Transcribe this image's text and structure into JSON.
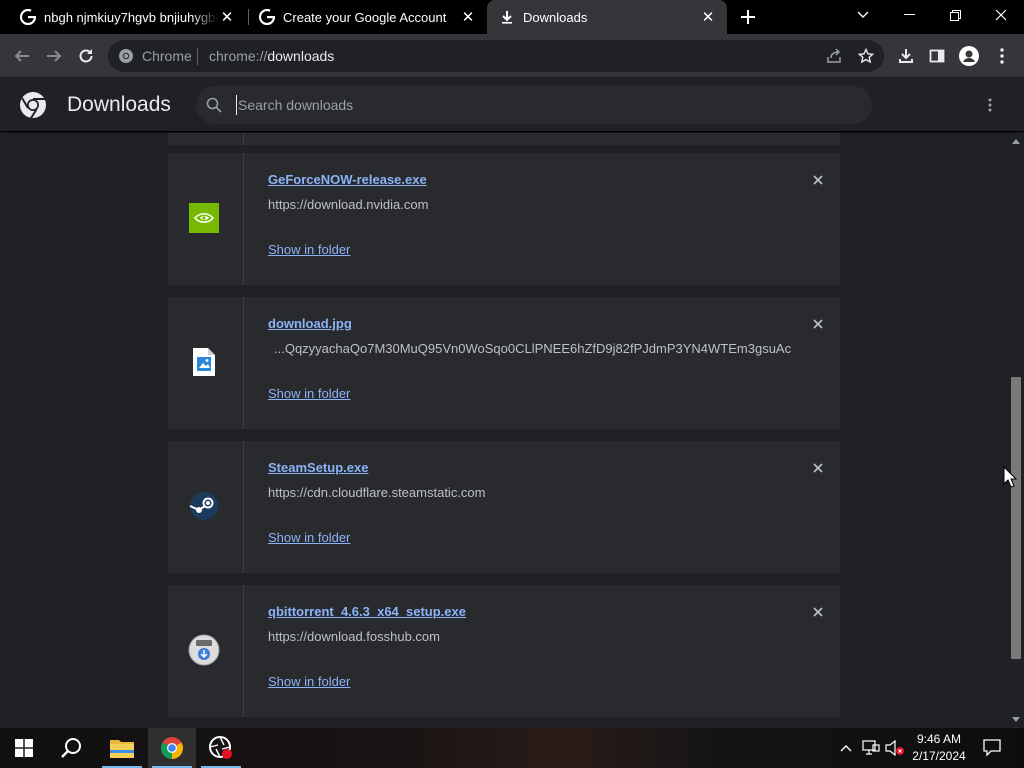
{
  "browser": {
    "tabs": [
      {
        "title": "nbgh njmkiuy7hgvb bnjiuhygbh",
        "active": false
      },
      {
        "title": "Create your Google Account",
        "active": false
      },
      {
        "title": "Downloads",
        "active": true
      }
    ],
    "omnibox": {
      "scheme_label": "Chrome",
      "url_prefix": "chrome://",
      "url_host": "downloads"
    }
  },
  "page": {
    "title": "Downloads",
    "search_placeholder": "Search downloads"
  },
  "downloads": [
    {
      "filename": "GeForceNOW-release.exe",
      "source": "https://download.nvidia.com",
      "action": "Show in folder",
      "icon": "nvidia-icon"
    },
    {
      "filename": "download.jpg",
      "source": "...QqzyyachaQo7M30MuQ95Vn0WoSqo0CLlPNEE6hZfD9j82fPJdmP3YN4WTEm3gsuAc",
      "action": "Show in folder",
      "icon": "image-file-icon"
    },
    {
      "filename": "SteamSetup.exe",
      "source": "https://cdn.cloudflare.steamstatic.com",
      "action": "Show in folder",
      "icon": "steam-icon"
    },
    {
      "filename": "qbittorrent_4.6.3_x64_setup.exe",
      "source": "https://download.fosshub.com",
      "action": "Show in folder",
      "icon": "installer-icon"
    }
  ],
  "taskbar": {
    "time": "9:46 AM",
    "date": "2/17/2024"
  },
  "colors": {
    "link": "#8ab4f8",
    "card_bg": "#292a2d",
    "page_bg": "#202124",
    "toolbar_bg": "#35363a"
  }
}
